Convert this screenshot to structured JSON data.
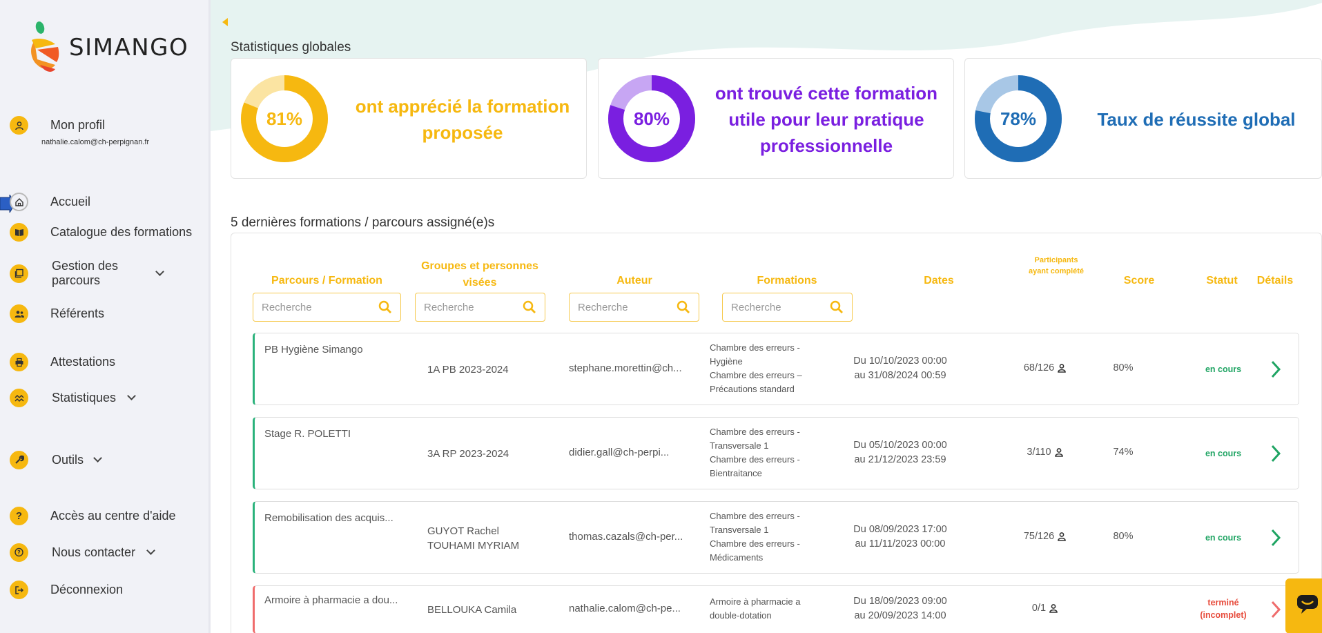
{
  "brand": {
    "name": "SIMANGO"
  },
  "profile": {
    "label": "Mon profil",
    "email": "nathalie.calom@ch-perpignan.fr"
  },
  "nav": {
    "home": "Accueil",
    "catalogue": "Catalogue des formations",
    "parcours": "Gestion des parcours",
    "referents": "Référents",
    "attestations": "Attestations",
    "statistiques": "Statistiques",
    "outils": "Outils",
    "aide": "Accès au centre d'aide",
    "contact": "Nous contacter",
    "logout": "Déconnexion"
  },
  "stats": {
    "title": "Statistiques globales",
    "cards": [
      {
        "value": "81%",
        "fraction": 0.81,
        "text": "ont apprécié la formation proposée",
        "color": "#f6b810",
        "track": "#fbe4a2"
      },
      {
        "value": "80%",
        "fraction": 0.8,
        "text": "ont trouvé cette formation utile pour leur pratique professionnelle",
        "color": "#7a1fe0",
        "track": "#c7a6f3"
      },
      {
        "value": "78%",
        "fraction": 0.78,
        "text": "Taux de réussite global",
        "color": "#1f6db5",
        "track": "#a8c7e6"
      }
    ]
  },
  "table": {
    "title": "5 dernières formations / parcours assigné(e)s",
    "headers": {
      "parcours": "Parcours / Formation",
      "groupes": "Groupes et personnes visées",
      "auteur": "Auteur",
      "formations": "Formations",
      "dates": "Dates",
      "participants": "Participants ayant complété",
      "score": "Score",
      "statut": "Statut",
      "details": "Détails"
    },
    "search_placeholder": "Recherche",
    "rows": [
      {
        "name": "PB Hygiène Simango",
        "group": "1A PB 2023-2024",
        "author": "stephane.morettin@ch...",
        "formations": [
          "Chambre des erreurs -",
          "Hygiène",
          "Chambre des erreurs –",
          "Précautions standard"
        ],
        "dates": [
          "Du 10/10/2023 00:00",
          "au 31/08/2024 00:59"
        ],
        "participants": "68/126",
        "score": "80%",
        "status": "en cours"
      },
      {
        "name": "Stage R. POLETTI",
        "group": "3A RP 2023-2024",
        "author": "didier.gall@ch-perpi...",
        "formations": [
          "Chambre des erreurs -",
          "Transversale 1",
          "Chambre des erreurs -",
          "Bientraitance"
        ],
        "dates": [
          "Du 05/10/2023 00:00",
          "au 21/12/2023 23:59"
        ],
        "participants": "3/110",
        "score": "74%",
        "status": "en cours"
      },
      {
        "name": "Remobilisation des acquis...",
        "group": [
          "GUYOT Rachel",
          "TOUHAMI MYRIAM"
        ],
        "author": "thomas.cazals@ch-per...",
        "formations": [
          "Chambre des erreurs -",
          "Transversale 1",
          "Chambre des erreurs -",
          "Médicaments"
        ],
        "dates": [
          "Du 08/09/2023 17:00",
          "au 11/11/2023 00:00"
        ],
        "participants": "75/126",
        "score": "80%",
        "status": "en cours"
      },
      {
        "name": "Armoire à pharmacie a dou...",
        "group": "BELLOUKA Camila",
        "author": "nathalie.calom@ch-pe...",
        "formations": [
          "Armoire à pharmacie a",
          "double-dotation"
        ],
        "dates": [
          "Du 18/09/2023 09:00",
          "au 20/09/2023 14:00"
        ],
        "participants": "0/1",
        "score": "",
        "status": [
          "terminé",
          "(incomplet)"
        ]
      }
    ]
  },
  "colors": {
    "accent": "#f6b810",
    "green": "#1fa463",
    "red": "#e74c3c"
  }
}
